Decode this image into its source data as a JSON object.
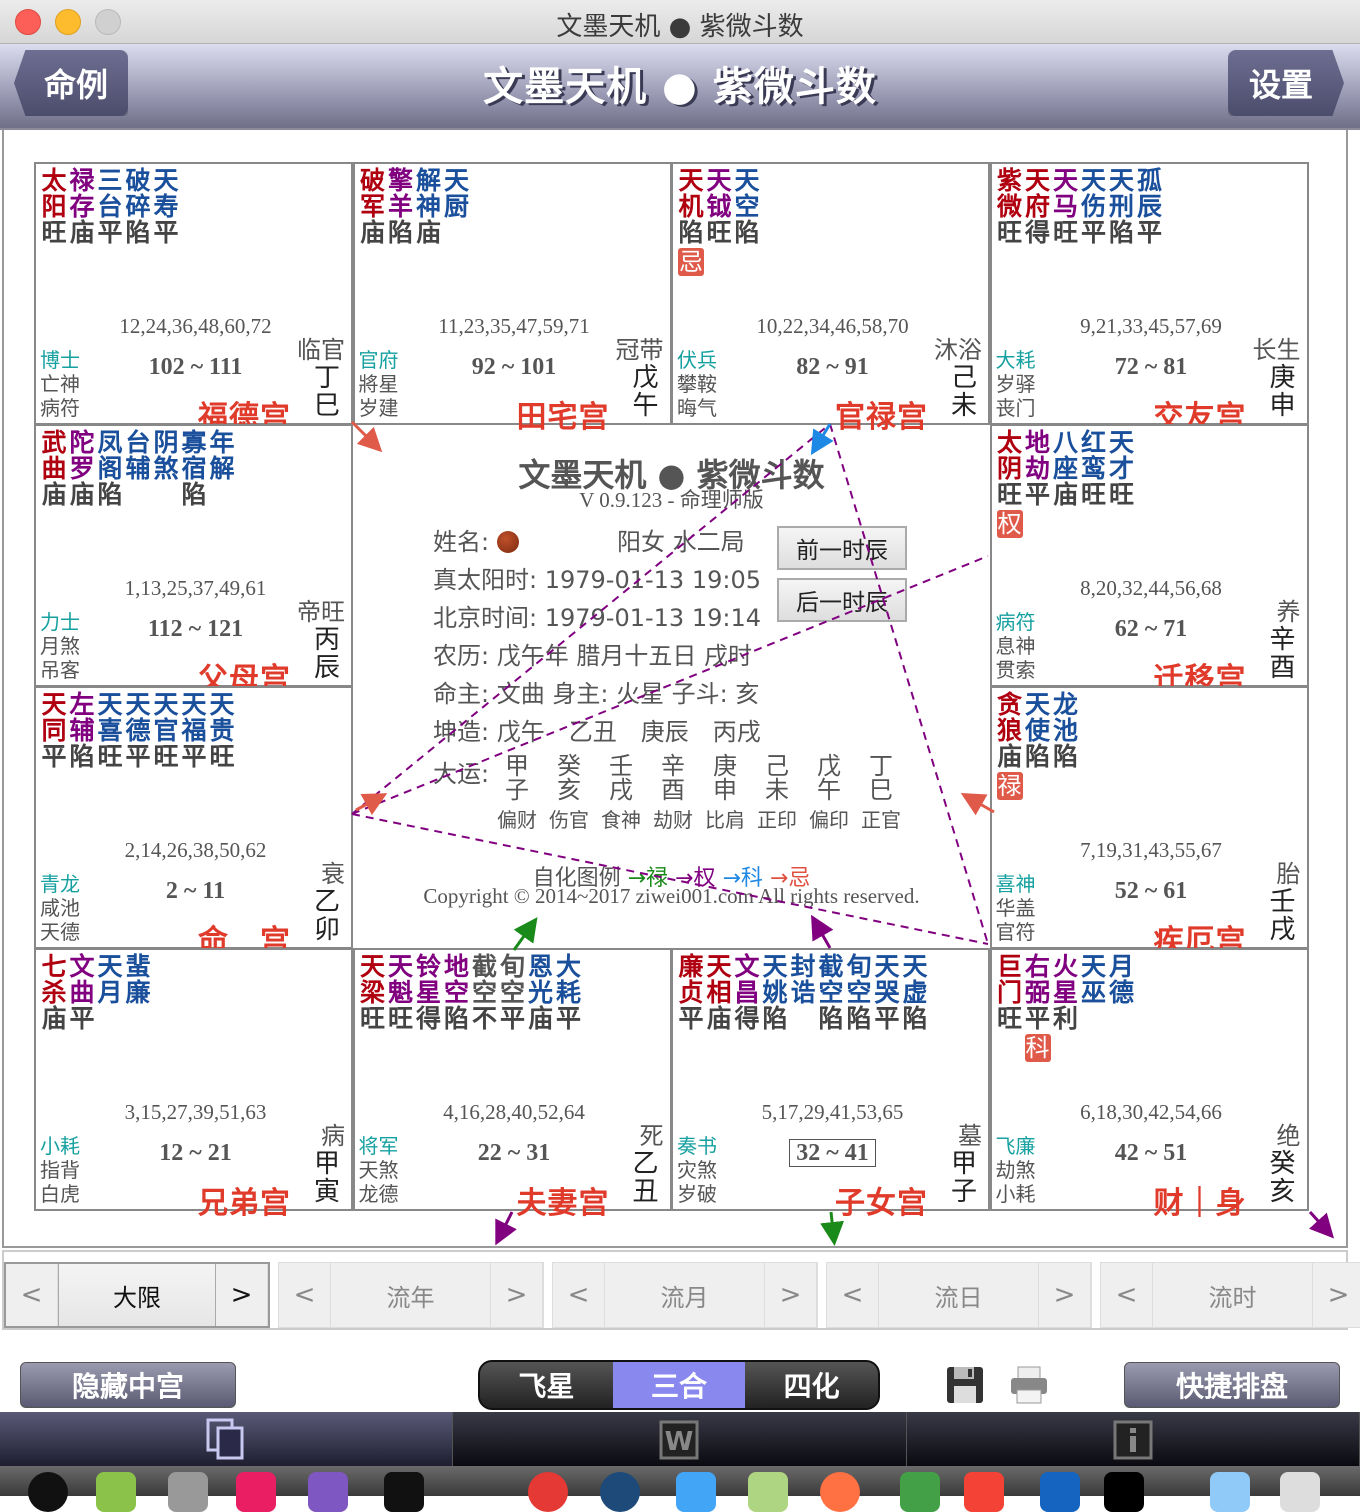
{
  "window": {
    "title": "文墨天机 ● 紫微斗数"
  },
  "navbar": {
    "title": "文墨天机 ● 紫微斗数",
    "back_label": "命例",
    "settings_label": "设置"
  },
  "palaces": [
    {
      "id": "si",
      "stars": [
        {
          "top": "太",
          "bot": "阳",
          "cls": "c-main",
          "bright": "旺"
        },
        {
          "top": "禄",
          "bot": "存",
          "cls": "c-aux",
          "bright": "庙"
        },
        {
          "top": "三",
          "bot": "台",
          "cls": "c-minor",
          "bright": "平"
        },
        {
          "top": "破",
          "bot": "碎",
          "cls": "c-minor",
          "bright": "陷"
        },
        {
          "top": "天",
          "bot": "寿",
          "cls": "c-minor",
          "bright": "平"
        }
      ],
      "ages": "12,24,36,48,60,72",
      "daxian": "102 ~ 111",
      "gods": [
        "博士",
        "亡神",
        "病符"
      ],
      "changsheng": "临官",
      "ganzhi": [
        "丁",
        "巳"
      ],
      "name": "福德宫"
    },
    {
      "id": "wu",
      "stars": [
        {
          "top": "破",
          "bot": "军",
          "cls": "c-main",
          "bright": "庙"
        },
        {
          "top": "擎",
          "bot": "羊",
          "cls": "c-aux",
          "bright": "陷"
        },
        {
          "top": "解",
          "bot": "神",
          "cls": "c-minor",
          "bright": "庙"
        },
        {
          "top": "天",
          "bot": "厨",
          "cls": "c-minor",
          "bright": ""
        }
      ],
      "ages": "11,23,35,47,59,71",
      "daxian": "92 ~ 101",
      "gods": [
        "官府",
        "將星",
        "岁建"
      ],
      "changsheng": "冠带",
      "ganzhi": [
        "戊",
        "午"
      ],
      "name": "田宅宫"
    },
    {
      "id": "wei",
      "stars": [
        {
          "top": "天",
          "bot": "机",
          "cls": "c-main",
          "bright": "陷",
          "sihua": "忌"
        },
        {
          "top": "天",
          "bot": "钺",
          "cls": "c-aux",
          "bright": "旺"
        },
        {
          "top": "天",
          "bot": "空",
          "cls": "c-minor",
          "bright": "陷"
        }
      ],
      "ages": "10,22,34,46,58,70",
      "daxian": "82 ~ 91",
      "gods": [
        "伏兵",
        "攀鞍",
        "晦气"
      ],
      "changsheng": "沐浴",
      "ganzhi": [
        "己",
        "未"
      ],
      "name": "官禄宫"
    },
    {
      "id": "shen",
      "stars": [
        {
          "top": "紫",
          "bot": "微",
          "cls": "c-main",
          "bright": "旺"
        },
        {
          "top": "天",
          "bot": "府",
          "cls": "c-main",
          "bright": "得"
        },
        {
          "top": "天",
          "bot": "马",
          "cls": "c-aux",
          "bright": "旺"
        },
        {
          "top": "天",
          "bot": "伤",
          "cls": "c-minor",
          "bright": "平"
        },
        {
          "top": "天",
          "bot": "刑",
          "cls": "c-minor",
          "bright": "陷"
        },
        {
          "top": "孤",
          "bot": "辰",
          "cls": "c-minor",
          "bright": "平"
        }
      ],
      "ages": "9,21,33,45,57,69",
      "daxian": "72 ~ 81",
      "gods": [
        "大耗",
        "岁驿",
        "丧门"
      ],
      "changsheng": "长生",
      "ganzhi": [
        "庚",
        "申"
      ],
      "name": "交友宫"
    },
    {
      "id": "chen",
      "stars": [
        {
          "top": "武",
          "bot": "曲",
          "cls": "c-main",
          "bright": "庙"
        },
        {
          "top": "陀",
          "bot": "罗",
          "cls": "c-aux",
          "bright": "庙"
        },
        {
          "top": "凤",
          "bot": "阁",
          "cls": "c-minor",
          "bright": "陷"
        },
        {
          "top": "台",
          "bot": "辅",
          "cls": "c-minor",
          "bright": ""
        },
        {
          "top": "阴",
          "bot": "煞",
          "cls": "c-minor",
          "bright": ""
        },
        {
          "top": "寡",
          "bot": "宿",
          "cls": "c-minor",
          "bright": "陷"
        },
        {
          "top": "年",
          "bot": "解",
          "cls": "c-minor",
          "bright": ""
        }
      ],
      "ages": "1,13,25,37,49,61",
      "daxian": "112 ~ 121",
      "gods": [
        "力士",
        "月煞",
        "吊客"
      ],
      "changsheng": "帝旺",
      "ganzhi": [
        "丙",
        "辰"
      ],
      "name": "父母宫"
    },
    {
      "id": "you",
      "stars": [
        {
          "top": "太",
          "bot": "阴",
          "cls": "c-main",
          "bright": "旺",
          "sihua": "权"
        },
        {
          "top": "地",
          "bot": "劫",
          "cls": "c-aux",
          "bright": "平"
        },
        {
          "top": "八",
          "bot": "座",
          "cls": "c-minor",
          "bright": "庙"
        },
        {
          "top": "红",
          "bot": "鸾",
          "cls": "c-minor",
          "bright": "旺"
        },
        {
          "top": "天",
          "bot": "才",
          "cls": "c-minor",
          "bright": "旺"
        }
      ],
      "ages": "8,20,32,44,56,68",
      "daxian": "62 ~ 71",
      "gods": [
        "病符",
        "息神",
        "贯索"
      ],
      "changsheng": "养",
      "ganzhi": [
        "辛",
        "酉"
      ],
      "name": "迁移宫"
    },
    {
      "id": "mao",
      "stars": [
        {
          "top": "天",
          "bot": "同",
          "cls": "c-main",
          "bright": "平"
        },
        {
          "top": "左",
          "bot": "辅",
          "cls": "c-aux",
          "bright": "陷"
        },
        {
          "top": "天",
          "bot": "喜",
          "cls": "c-minor",
          "bright": "旺"
        },
        {
          "top": "天",
          "bot": "德",
          "cls": "c-minor",
          "bright": "平"
        },
        {
          "top": "天",
          "bot": "官",
          "cls": "c-minor",
          "bright": "旺"
        },
        {
          "top": "天",
          "bot": "福",
          "cls": "c-minor",
          "bright": "平"
        },
        {
          "top": "天",
          "bot": "贵",
          "cls": "c-minor",
          "bright": "旺"
        }
      ],
      "ages": "2,14,26,38,50,62",
      "daxian": "2 ~ 11",
      "gods": [
        "青龙",
        "咸池",
        "天德"
      ],
      "changsheng": "衰",
      "ganzhi": [
        "乙",
        "卯"
      ],
      "name": "命　宫"
    },
    {
      "id": "xu",
      "stars": [
        {
          "top": "贪",
          "bot": "狼",
          "cls": "c-main",
          "bright": "庙",
          "sihua": "禄"
        },
        {
          "top": "天",
          "bot": "使",
          "cls": "c-minor",
          "bright": "陷"
        },
        {
          "top": "龙",
          "bot": "池",
          "cls": "c-minor",
          "bright": "陷"
        }
      ],
      "ages": "7,19,31,43,55,67",
      "daxian": "52 ~ 61",
      "gods": [
        "喜神",
        "华盖",
        "官符"
      ],
      "changsheng": "胎",
      "ganzhi": [
        "壬",
        "戌"
      ],
      "name": "疾厄宫"
    },
    {
      "id": "yin",
      "stars": [
        {
          "top": "七",
          "bot": "杀",
          "cls": "c-main",
          "bright": "庙"
        },
        {
          "top": "文",
          "bot": "曲",
          "cls": "c-aux",
          "bright": "平"
        },
        {
          "top": "天",
          "bot": "月",
          "cls": "c-minor",
          "bright": ""
        },
        {
          "top": "蜚",
          "bot": "廉",
          "cls": "c-minor",
          "bright": ""
        }
      ],
      "ages": "3,15,27,39,51,63",
      "daxian": "12 ~ 21",
      "gods": [
        "小耗",
        "指背",
        "白虎"
      ],
      "changsheng": "病",
      "ganzhi": [
        "甲",
        "寅"
      ],
      "name": "兄弟宫"
    },
    {
      "id": "chou",
      "stars": [
        {
          "top": "天",
          "bot": "梁",
          "cls": "c-main",
          "bright": "旺"
        },
        {
          "top": "天",
          "bot": "魁",
          "cls": "c-aux",
          "bright": "旺"
        },
        {
          "top": "铃",
          "bot": "星",
          "cls": "c-aux",
          "bright": "得"
        },
        {
          "top": "地",
          "bot": "空",
          "cls": "c-aux",
          "bright": "陷"
        },
        {
          "top": "截",
          "bot": "空",
          "cls": "c-gray",
          "bright": "不"
        },
        {
          "top": "旬",
          "bot": "空",
          "cls": "c-gray",
          "bright": "平"
        },
        {
          "top": "恩",
          "bot": "光",
          "cls": "c-minor",
          "bright": "庙"
        },
        {
          "top": "大",
          "bot": "耗",
          "cls": "c-minor",
          "bright": "平"
        }
      ],
      "ages": "4,16,28,40,52,64",
      "daxian": "22 ~ 31",
      "gods": [
        "将军",
        "天煞",
        "龙德"
      ],
      "changsheng": "死",
      "ganzhi": [
        "乙",
        "丑"
      ],
      "name": "夫妻宫"
    },
    {
      "id": "zi",
      "stars": [
        {
          "top": "廉",
          "bot": "贞",
          "cls": "c-main",
          "bright": "平"
        },
        {
          "top": "天",
          "bot": "相",
          "cls": "c-main",
          "bright": "庙"
        },
        {
          "top": "文",
          "bot": "昌",
          "cls": "c-aux",
          "bright": "得"
        },
        {
          "top": "天",
          "bot": "姚",
          "cls": "c-minor",
          "bright": "陷"
        },
        {
          "top": "封",
          "bot": "诰",
          "cls": "c-minor",
          "bright": ""
        },
        {
          "top": "截",
          "bot": "空",
          "cls": "c-minor",
          "bright": "陷"
        },
        {
          "top": "旬",
          "bot": "空",
          "cls": "c-minor",
          "bright": "陷"
        },
        {
          "top": "天",
          "bot": "哭",
          "cls": "c-minor",
          "bright": "平"
        },
        {
          "top": "天",
          "bot": "虚",
          "cls": "c-minor",
          "bright": "陷"
        }
      ],
      "ages": "5,17,29,41,53,65",
      "daxian": "32 ~ 41",
      "daxian_selected": true,
      "gods": [
        "奏书",
        "灾煞",
        "岁破"
      ],
      "changsheng": "墓",
      "ganzhi": [
        "甲",
        "子"
      ],
      "name": "子女宫"
    },
    {
      "id": "hai",
      "stars": [
        {
          "top": "巨",
          "bot": "门",
          "cls": "c-main",
          "bright": "旺"
        },
        {
          "top": "右",
          "bot": "弼",
          "cls": "c-aux",
          "bright": "平",
          "sihua": "科"
        },
        {
          "top": "火",
          "bot": "星",
          "cls": "c-aux",
          "bright": "利"
        },
        {
          "top": "天",
          "bot": "巫",
          "cls": "c-minor",
          "bright": ""
        },
        {
          "top": "月",
          "bot": "德",
          "cls": "c-minor",
          "bright": ""
        }
      ],
      "ages": "6,18,30,42,54,66",
      "daxian": "42 ~ 51",
      "gods": [
        "飞廉",
        "劫煞",
        "小耗"
      ],
      "changsheng": "绝",
      "ganzhi": [
        "癸",
        "亥"
      ],
      "name": "财｜身"
    }
  ],
  "center": {
    "title": "文墨天机 ● 紫微斗数",
    "version": "V 0.9.123 - 命理师版",
    "name_label": "姓名:",
    "gender_ju": "阳女 水二局",
    "solar_time": "真太阳时: 1979-01-13 19:05",
    "beijing_time": "北京时间: 1979-01-13 19:14",
    "lunar": "农历: 戊午年 腊月十五日 戌时",
    "masters": "命主: 文曲 身主: 火星 子斗: 亥",
    "bazi": "坤造: 戊午　乙丑　庚辰　丙戌",
    "dayun_label": "大运:",
    "dayun": [
      {
        "gan": "甲",
        "zhi": "子",
        "ss": "偏财"
      },
      {
        "gan": "癸",
        "zhi": "亥",
        "ss": "伤官"
      },
      {
        "gan": "壬",
        "zhi": "戌",
        "ss": "食神"
      },
      {
        "gan": "辛",
        "zhi": "酉",
        "ss": "劫财"
      },
      {
        "gan": "庚",
        "zhi": "申",
        "ss": "比肩"
      },
      {
        "gan": "己",
        "zhi": "未",
        "ss": "正印"
      },
      {
        "gan": "戊",
        "zhi": "午",
        "ss": "偏印"
      },
      {
        "gan": "丁",
        "zhi": "巳",
        "ss": "正官"
      }
    ],
    "prev_hour_label": "前一时辰",
    "next_hour_label": "后一时辰",
    "legend_label": "自化图例",
    "legend": [
      {
        "label": "→禄",
        "color": "#1a8a1a"
      },
      {
        "label": "→权",
        "color": "#800080"
      },
      {
        "label": "→科",
        "color": "#1e88e5"
      },
      {
        "label": "→忌",
        "color": "#e05040"
      }
    ],
    "copyright": "Copyright © 2014~2017 ziwei001.com All rights reserved."
  },
  "period_nav": [
    {
      "label": "大限",
      "active": true
    },
    {
      "label": "流年",
      "active": false
    },
    {
      "label": "流月",
      "active": false
    },
    {
      "label": "流日",
      "active": false
    },
    {
      "label": "流时",
      "active": false
    }
  ],
  "period_prev": "<",
  "period_next": ">",
  "toolbar": {
    "hide_center_label": "隐藏中宫",
    "modes": [
      {
        "label": "飞星",
        "active": false
      },
      {
        "label": "三合",
        "active": true
      },
      {
        "label": "四化",
        "active": false
      }
    ],
    "quick_chart_label": "快捷排盘",
    "save_icon": "floppy-disk-icon",
    "print_icon": "printer-icon"
  },
  "tabbar": [
    {
      "icon": "copy-icon",
      "active": true
    },
    {
      "icon": "w-icon",
      "active": false
    },
    {
      "icon": "info-icon",
      "active": false
    }
  ],
  "colors": {
    "main_star": "#b00010",
    "aux_star": "#800080",
    "minor_star": "#1a4f9c",
    "palace_name": "#e03a2a",
    "god": "#16a0a0",
    "sihua_badge": "#e05a4a",
    "active_mode": "#8888ee"
  }
}
